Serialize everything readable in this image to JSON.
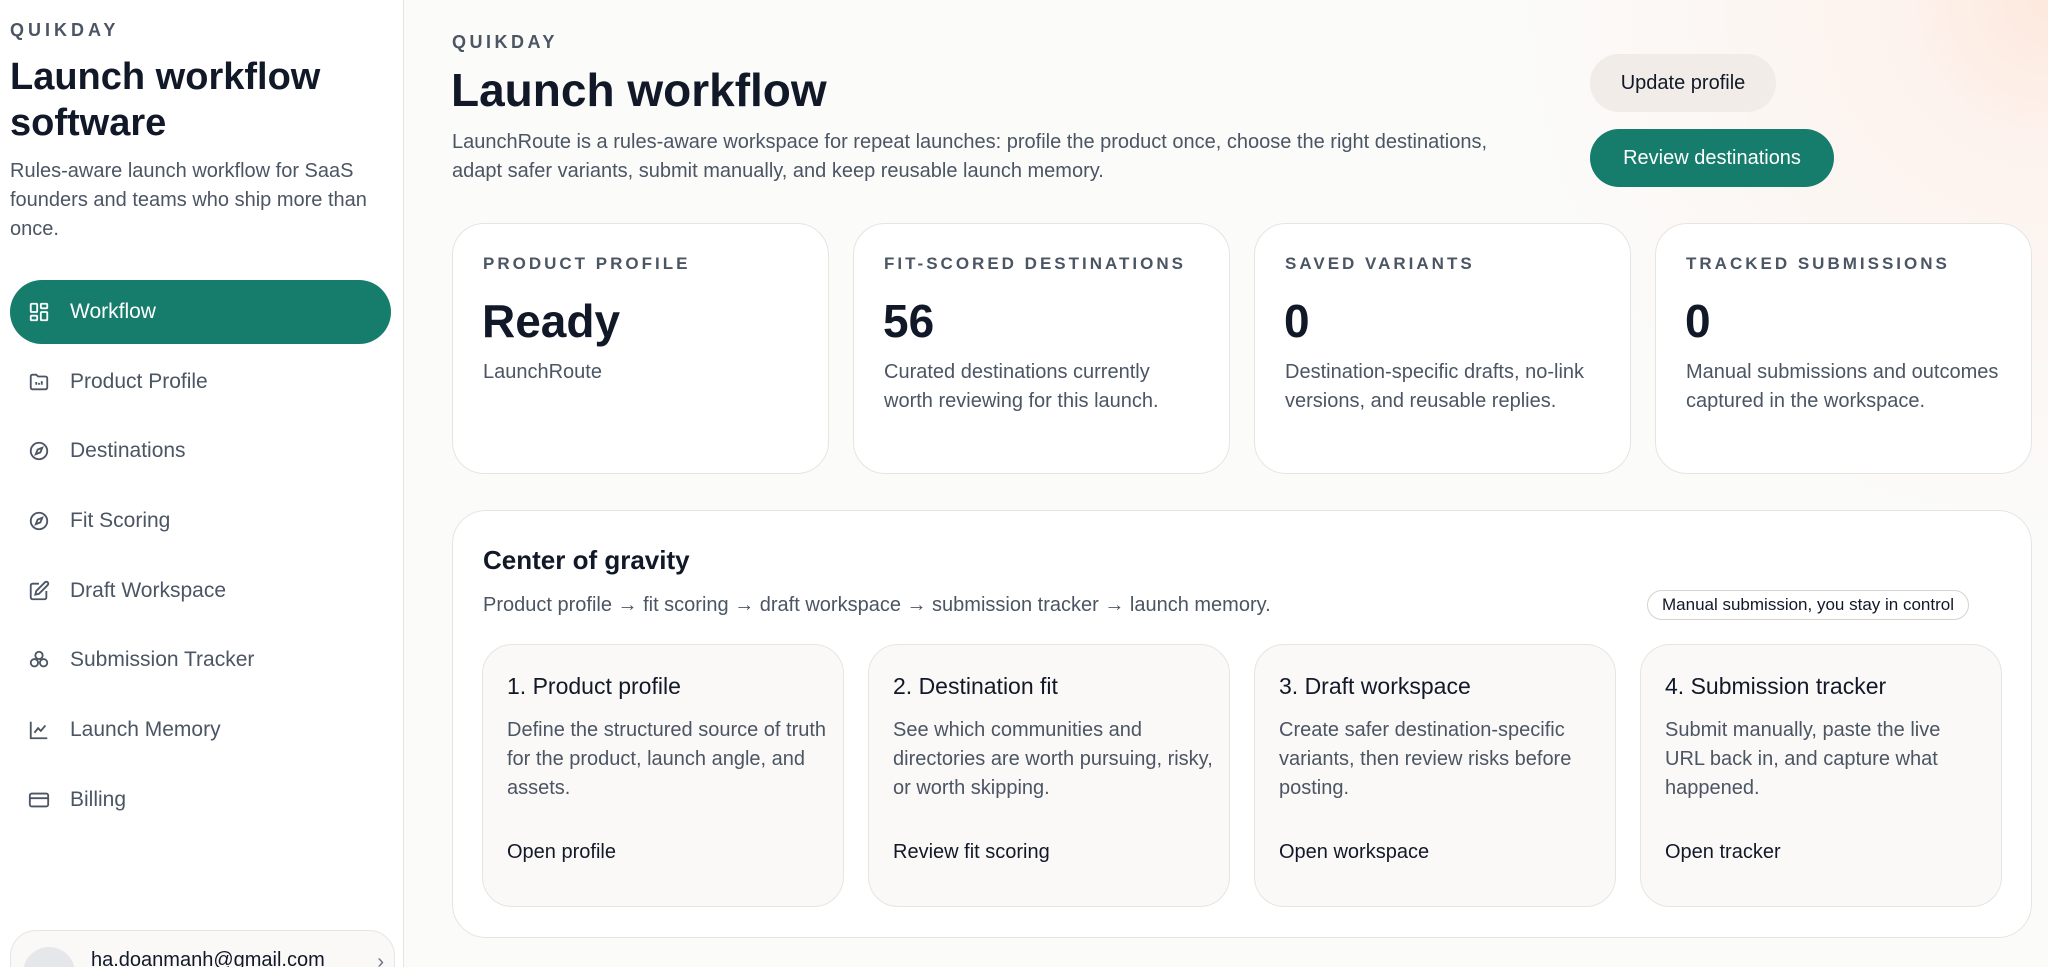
{
  "sidebar": {
    "brand": "QUIKDAY",
    "title": "Launch workflow software",
    "description": "Rules-aware launch workflow for SaaS founders and teams who ship more than once.",
    "nav": [
      {
        "label": "Workflow",
        "icon": "dashboard-icon",
        "active": true
      },
      {
        "label": "Product Profile",
        "icon": "folder-icon",
        "active": false
      },
      {
        "label": "Destinations",
        "icon": "compass-icon",
        "active": false
      },
      {
        "label": "Fit Scoring",
        "icon": "compass-icon",
        "active": false
      },
      {
        "label": "Draft Workspace",
        "icon": "edit-icon",
        "active": false
      },
      {
        "label": "Submission Tracker",
        "icon": "boxes-icon",
        "active": false
      },
      {
        "label": "Launch Memory",
        "icon": "chart-line-icon",
        "active": false
      },
      {
        "label": "Billing",
        "icon": "credit-card-icon",
        "active": false
      }
    ],
    "account": {
      "email": "ha.doanmanh@gmail.com"
    }
  },
  "header": {
    "brand": "QUIKDAY",
    "title": "Launch workflow",
    "subtitle": "LaunchRoute is a rules-aware workspace for repeat launches: profile the product once, choose the right destinations, adapt safer variants, submit manually, and keep reusable launch memory.",
    "update_label": "Update profile",
    "review_label": "Review destinations"
  },
  "stats": [
    {
      "label": "PRODUCT PROFILE",
      "value": "Ready",
      "desc": "LaunchRoute"
    },
    {
      "label": "FIT-SCORED DESTINATIONS",
      "value": "56",
      "desc": "Curated destinations currently worth reviewing for this launch."
    },
    {
      "label": "SAVED VARIANTS",
      "value": "0",
      "desc": "Destination-specific drafts, no-link versions, and reusable replies."
    },
    {
      "label": "TRACKED SUBMISSIONS",
      "value": "0",
      "desc": "Manual submissions and outcomes captured in the workspace."
    }
  ],
  "gravity": {
    "title": "Center of gravity",
    "flow": "Product profile → fit scoring → draft workspace → submission tracker → launch memory.",
    "pill": "Manual submission, you stay in control",
    "steps": [
      {
        "title": "1. Product profile",
        "desc": "Define the structured source of truth for the product, launch angle, and assets.",
        "link": "Open profile"
      },
      {
        "title": "2. Destination fit",
        "desc": "See which communities and directories are worth pursuing, risky, or worth skipping.",
        "link": "Review fit scoring"
      },
      {
        "title": "3. Draft workspace",
        "desc": "Create safer destination-specific variants, then review risks before posting.",
        "link": "Open workspace"
      },
      {
        "title": "4. Submission tracker",
        "desc": "Submit manually, paste the live URL back in, and capture what happened.",
        "link": "Open tracker"
      }
    ]
  },
  "colors": {
    "accent": "#167c6c",
    "text": "#111827",
    "muted": "#4b5563",
    "border": "#e7e5e2"
  }
}
